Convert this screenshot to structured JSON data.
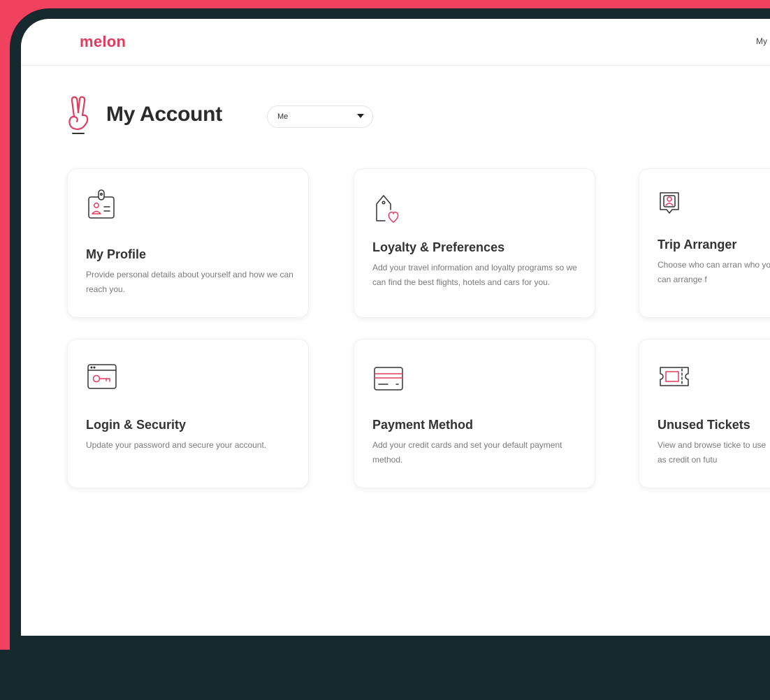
{
  "header": {
    "logo": "melon",
    "nav_item": "My"
  },
  "page": {
    "title": "My Account",
    "selector_value": "Me"
  },
  "cards": [
    {
      "title": "My Profile",
      "description": "Provide personal details about yourself and how we can reach you.",
      "icon": "id-badge-icon"
    },
    {
      "title": "Loyalty & Preferences",
      "description": "Add your travel information and loyalty programs so we can find the best flights, hotels and cars for you.",
      "icon": "tag-heart-icon"
    },
    {
      "title": "Trip Arranger",
      "description": "Choose who can arran who you can arrange f",
      "icon": "person-frame-icon"
    },
    {
      "title": "Login & Security",
      "description": "Update your password and secure your account.",
      "icon": "browser-key-icon"
    },
    {
      "title": "Payment Method",
      "description": "Add your credit cards and set your default payment method.",
      "icon": "credit-card-icon"
    },
    {
      "title": "Unused Tickets",
      "description": "View and browse ticke to use as credit on futu",
      "icon": "ticket-icon"
    }
  ],
  "colors": {
    "accent": "#e33a5e",
    "frame": "#f0415f",
    "bezel": "#16292f"
  }
}
